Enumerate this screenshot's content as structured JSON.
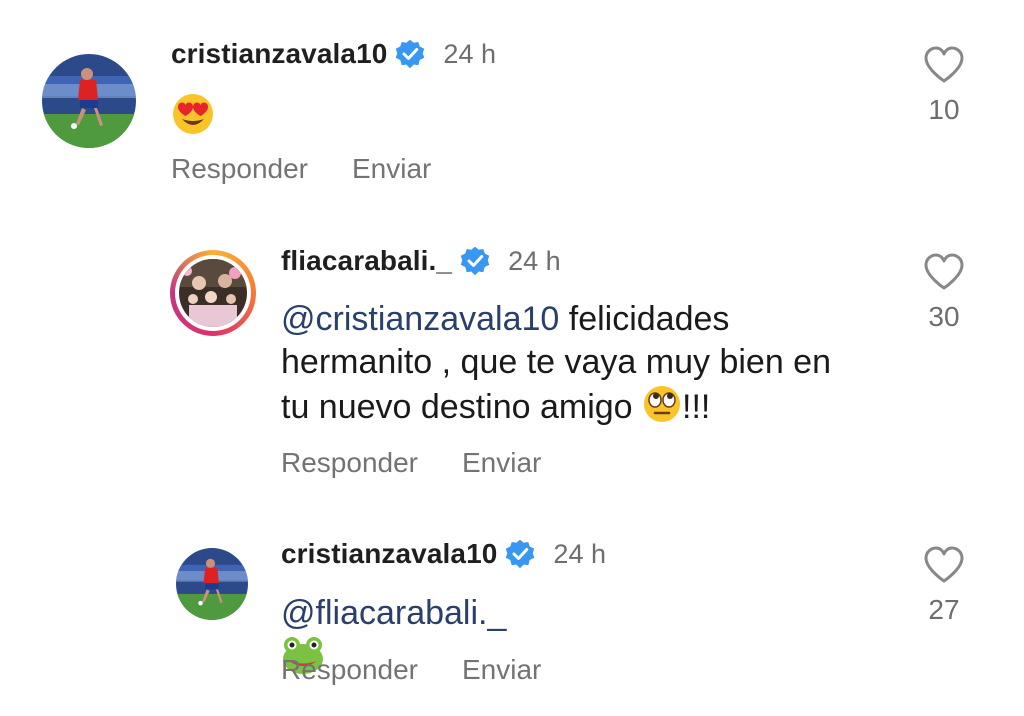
{
  "comments": [
    {
      "username": "cristianzavala10",
      "verified": true,
      "time": "24 h",
      "text_parts": [],
      "emoji": "heart-eyes",
      "reply_label": "Responder",
      "send_label": "Enviar",
      "likes": "10"
    },
    {
      "username": "fliacarabali._",
      "verified": true,
      "time": "24 h",
      "mention": "@cristianzavala10",
      "line1_rest": " felicidades",
      "line2": "hermanito , que te vaya muy bien en",
      "line3_pre": "tu nuevo destino amigo ",
      "line3_post": "!!!",
      "emoji": "rolling-eyes",
      "reply_label": "Responder",
      "send_label": "Enviar",
      "likes": "30"
    },
    {
      "username": "cristianzavala10",
      "verified": true,
      "time": "24 h",
      "mention": "@fliacarabali._",
      "emoji": "frog",
      "reply_label": "Responder",
      "send_label": "Enviar",
      "likes": "27"
    }
  ],
  "colors": {
    "verified": "#3897f0",
    "mention": "#2a3f6b",
    "muted": "#737373"
  }
}
